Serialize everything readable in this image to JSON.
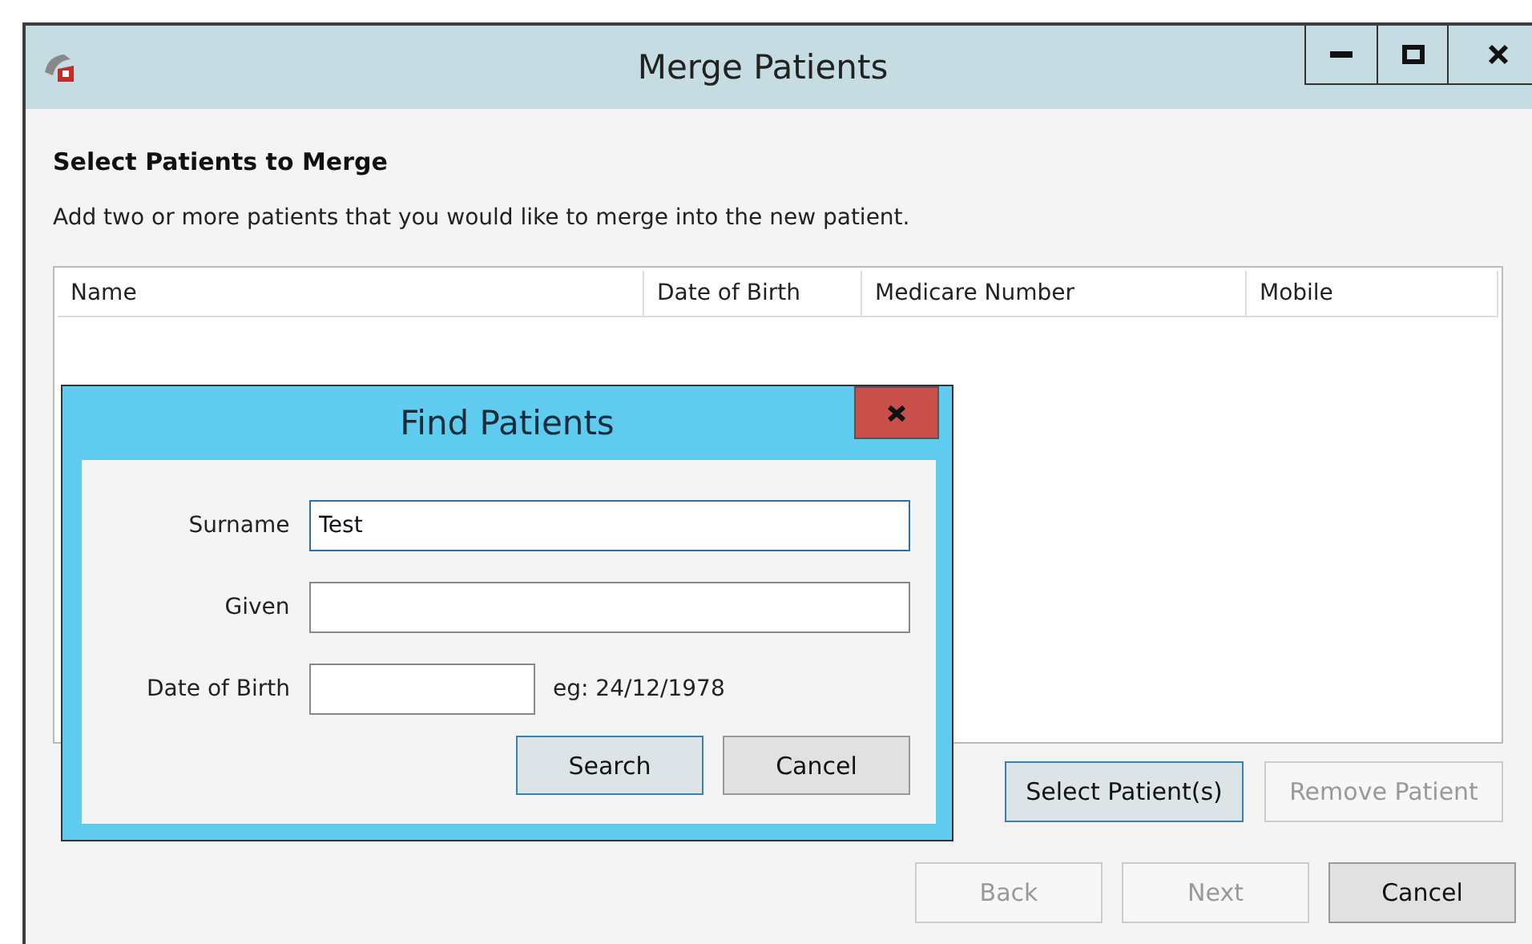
{
  "window": {
    "title": "Merge Patients"
  },
  "heading": "Select Patients to Merge",
  "description": "Add two or more patients that you would like to merge into the new patient.",
  "table": {
    "columns": [
      "Name",
      "Date of Birth",
      "Medicare Number",
      "Mobile"
    ]
  },
  "table_buttons": [
    {
      "label": "Select Patient(s)",
      "disabled": false,
      "focused": true
    },
    {
      "label": "Remove Patient",
      "disabled": true,
      "focused": false
    }
  ],
  "wizard_buttons": [
    {
      "label": "Back",
      "disabled": true,
      "focused": false
    },
    {
      "label": "Next",
      "disabled": true,
      "focused": false
    },
    {
      "label": "Cancel",
      "disabled": false,
      "focused": false
    }
  ],
  "dialog": {
    "title": "Find Patients",
    "fields": [
      {
        "label": "Surname",
        "value": "Test",
        "focused": true,
        "kind": "wide"
      },
      {
        "label": "Given",
        "focused": false,
        "kind": "wide"
      },
      {
        "label": "Date of Birth",
        "focused": false,
        "kind": "short",
        "hint": "eg: 24/12/1978"
      }
    ],
    "buttons": [
      {
        "label": "Search",
        "disabled": false,
        "focused": true
      },
      {
        "label": "Cancel",
        "disabled": false,
        "focused": false
      }
    ]
  }
}
